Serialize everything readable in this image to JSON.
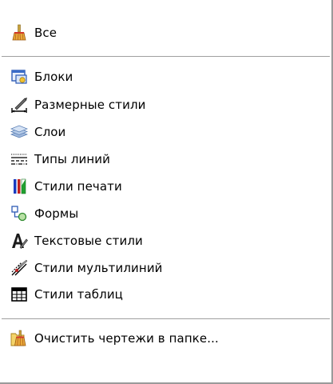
{
  "menu": {
    "items": [
      {
        "label": "Все",
        "icon": "broom-icon"
      },
      {
        "label": "Блоки",
        "icon": "block-icon"
      },
      {
        "label": "Размерные стили",
        "icon": "dimension-style-icon"
      },
      {
        "label": "Слои",
        "icon": "layers-icon"
      },
      {
        "label": "Типы линий",
        "icon": "linetype-icon"
      },
      {
        "label": "Стили печати",
        "icon": "plot-style-icon"
      },
      {
        "label": "Формы",
        "icon": "shapes-icon"
      },
      {
        "label": "Текстовые стили",
        "icon": "text-style-icon"
      },
      {
        "label": "Стили мультилиний",
        "icon": "multiline-style-icon"
      },
      {
        "label": "Стили таблиц",
        "icon": "table-style-icon"
      },
      {
        "label": "Очистить чертежи в папке...",
        "icon": "purge-folder-icon"
      }
    ]
  },
  "colors": {
    "border": "#9a9a9a",
    "separator": "#a0a0a0",
    "text": "#000000"
  }
}
